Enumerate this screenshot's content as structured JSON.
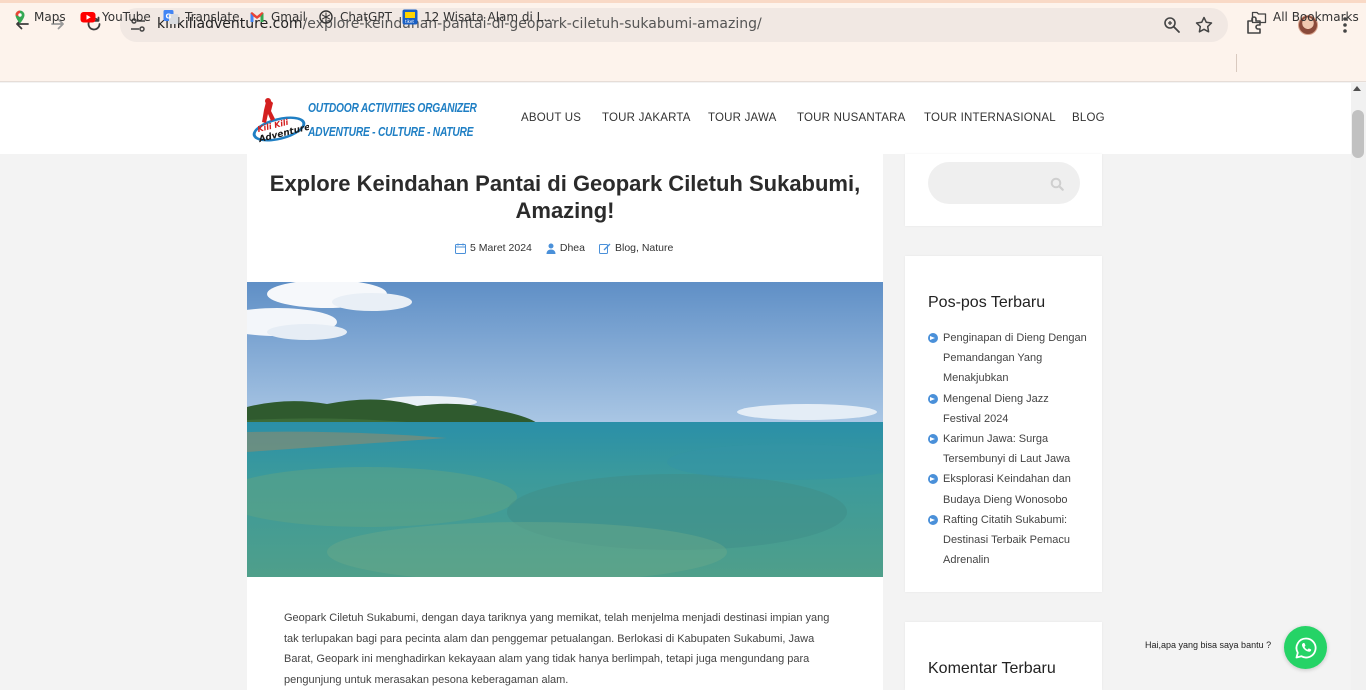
{
  "browser": {
    "url_host": "kilikiliadventure.com",
    "url_path": "/explore-keindahan-pantai-di-geopark-ciletuh-sukabumi-amazing/",
    "bookmarks": [
      {
        "label": "Maps",
        "icon": "maps-pin-icon"
      },
      {
        "label": "YouTube",
        "icon": "youtube-icon"
      },
      {
        "label": "Translate",
        "icon": "translate-icon"
      },
      {
        "label": "Gmail",
        "icon": "gmail-icon"
      },
      {
        "label": "ChatGPT",
        "icon": "chatgpt-icon"
      },
      {
        "label": "12 Wisata Alam di L...",
        "icon": "tiket-icon"
      }
    ],
    "all_bookmarks": "All Bookmarks"
  },
  "site": {
    "logo_line1": "OUTDOOR ACTIVITIES ORGANIZER",
    "logo_line2": "ADVENTURE - CULTURE - NATURE",
    "logo_badge": "Kili Kili Adventure",
    "menu": [
      "ABOUT US",
      "TOUR JAKARTA",
      "TOUR JAWA",
      "TOUR NUSANTARA",
      "TOUR INTERNASIONAL",
      "BLOG"
    ]
  },
  "post": {
    "title": "Explore Keindahan Pantai di Geopark Ciletuh Sukabumi, Amazing!",
    "date": "5 Maret 2024",
    "author": "Dhea",
    "categories": "Blog, Nature",
    "body": "Geopark Ciletuh Sukabumi, dengan daya tariknya yang memikat, telah menjelma menjadi destinasi impian yang tak terlupakan bagi para pecinta alam dan penggemar petualangan. Berlokasi di Kabupaten Sukabumi, Jawa Barat, Geopark ini menghadirkan kekayaan alam yang tidak hanya berlimpah, tetapi juga mengundang para pengunjung untuk merasakan pesona keberagaman alam."
  },
  "sidebar": {
    "search_placeholder": "",
    "recent_title": "Pos-pos Terbaru",
    "recent_posts": [
      "Penginapan di Dieng Dengan Pemandangan Yang Menakjubkan",
      "Mengenal Dieng Jazz Festival 2024",
      "Karimun Jawa: Surga Tersembunyi di Laut Jawa",
      "Eksplorasi Keindahan dan Budaya Dieng Wonosobo",
      "Rafting Citatih Sukabumi: Destinasi Terbaik Pemacu Adrenalin"
    ],
    "comments_title": "Komentar Terbaru"
  },
  "whatsapp": {
    "prompt": "Hai,apa yang bisa saya bantu ?"
  },
  "colors": {
    "accent": "#4a90d9",
    "whatsapp": "#25d366",
    "chrome_bg": "#fdf3ec"
  }
}
